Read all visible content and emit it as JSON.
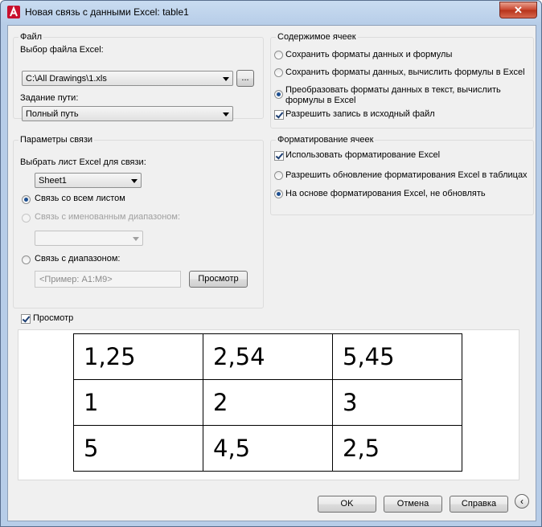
{
  "window": {
    "title": "Новая связь с данными Excel: table1",
    "close": "✕"
  },
  "file_group": {
    "title": "Файл",
    "select_label": "Выбор файла Excel:",
    "file_value": "C:\\All Drawings\\1.xls",
    "browse_label": "...",
    "path_label": "Задание пути:",
    "path_value": "Полный путь"
  },
  "link_group": {
    "title": "Параметры связи",
    "sheet_label": "Выбрать лист Excel для связи:",
    "sheet_value": "Sheet1",
    "radio_whole": "Связь со всем листом",
    "radio_named": "Связь с именованным диапазоном:",
    "radio_range": "Связь с диапазоном:",
    "range_placeholder": "<Пример: A1:M9>",
    "preview_button": "Просмотр"
  },
  "content_group": {
    "title": "Содержимое ячеек",
    "opt1": "Сохранить форматы данных и формулы",
    "opt2": "Сохранить форматы данных, вычислить формулы в Excel",
    "opt3_line1": "Преобразовать форматы данных в текст, вычислить",
    "opt3_line2": "формулы в Excel",
    "allow_write": "Разрешить запись в исходный файл"
  },
  "format_group": {
    "title": "Форматирование ячеек",
    "use_format": "Использовать форматирование Excel",
    "opt_update": "Разрешить обновление форматирования Excel в таблицах",
    "opt_no_update": "На основе форматирования Excel, не обновлять"
  },
  "preview": {
    "label": "Просмотр",
    "rows": [
      [
        "1,25",
        "2,54",
        "5,45"
      ],
      [
        "1",
        "2",
        "3"
      ],
      [
        "5",
        "4,5",
        "2,5"
      ]
    ]
  },
  "buttons": {
    "ok": "OK",
    "cancel": "Отмена",
    "help": "Справка",
    "more": "‹"
  }
}
